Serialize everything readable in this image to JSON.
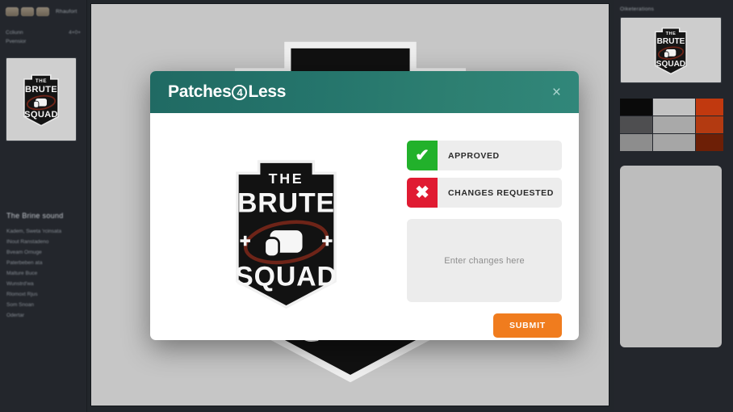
{
  "sidebar": {
    "toolbar_label": "Rhaufort",
    "chips": [
      "chip-icon-1",
      "chip-icon-2",
      "chip-icon-3"
    ],
    "meta_rows": [
      {
        "label": "Ccliunn",
        "value": "4+0+"
      },
      {
        "label": "Pvensior",
        "value": ""
      }
    ],
    "thumbnail_alt": "brute-squad-logo-thumbnail",
    "list_title": "The Brine sound",
    "list_items": [
      "Kadem, Sweta 'rcinsata",
      "INout Ranstadeno",
      "Bveam Ornuge",
      "Paterbeben ata",
      "Malture  Buce",
      "Wunstrd'wa",
      "Rlomoxt Rjus",
      "Som Snoan",
      "Odertar"
    ]
  },
  "canvas": {
    "artwork_alt": "the-brute-squad-patch-artwork"
  },
  "right_panel": {
    "label": "Oiketerations",
    "thumbnail_alt": "brute-squad-logo-thumbnail",
    "swatches": [
      "#0a0a0a",
      "#c3c3c3",
      "#c1390f",
      "#4e4e50",
      "#a9a9a9",
      "#b33a11",
      "#8d8d8d",
      "#a6a6a6",
      "#6d1f06"
    ],
    "placeholder_alt": "empty-preview-panel"
  },
  "modal": {
    "title_prefix": "Patches",
    "title_number": "4",
    "title_suffix": "Less",
    "close_label": "×",
    "preview_alt": "the-brute-squad-patch-proof",
    "approved_label": "APPROVED",
    "approved_icon": "✔",
    "approved_color": "#22b12b",
    "changes_label": "CHANGES REQUESTED",
    "changes_icon": "✖",
    "changes_color": "#e01b32",
    "changes_placeholder": "Enter changes here",
    "changes_value": "",
    "submit_label": "SUBMIT",
    "submit_color": "#f07c1e",
    "header_color": "#25756c"
  }
}
